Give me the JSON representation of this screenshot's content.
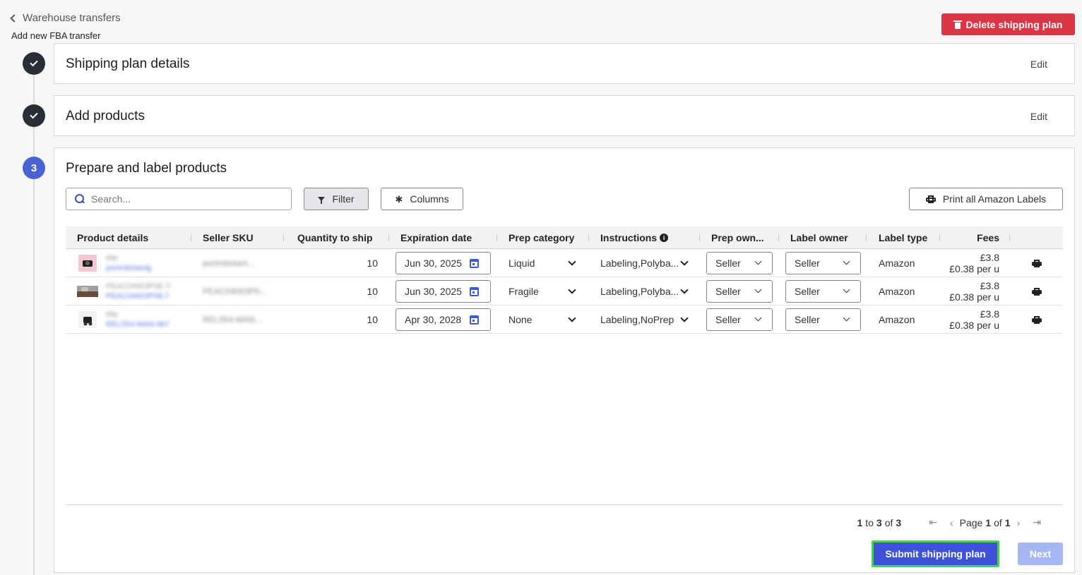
{
  "header": {
    "back_label": "Warehouse transfers",
    "subtitle": "Add new FBA transfer",
    "delete_label": "Delete shipping plan",
    "delete_color": "#dc3545"
  },
  "steps": [
    {
      "number": "",
      "status": "done",
      "title": "Shipping plan details",
      "edit_label": "Edit"
    },
    {
      "number": "",
      "status": "done",
      "title": "Add products",
      "edit_label": "Edit"
    },
    {
      "number": "3",
      "status": "active",
      "title": "Prepare and label products"
    }
  ],
  "toolbar": {
    "search_placeholder": "Search...",
    "filter_label": "Filter",
    "columns_label": "Columns",
    "print_all_label": "Print all Amazon Labels"
  },
  "table": {
    "columns": [
      "Product details",
      "Seller SKU",
      "Quantity to ship",
      "Expiration date",
      "Prep category",
      "Instructions",
      "Prep own...",
      "Label owner",
      "Label type",
      "Fees"
    ],
    "rows": [
      {
        "title": "title",
        "product_link": "portmbotanig",
        "sku": "portmbotani...",
        "quantity": "10",
        "expiration": "Jun 30, 2025",
        "prep_category": "Liquid",
        "instructions": "Labeling,Polyba...",
        "prep_owner": "Seller",
        "label_owner": "Seller",
        "label_type": "Amazon",
        "fee_1": "£3.8",
        "fee_2": "£0.38 per u"
      },
      {
        "title": "PEAC04003P08.7i",
        "product_link": "PEAC04003P08.7",
        "sku": "PEAC04003P0...",
        "quantity": "10",
        "expiration": "Jun 30, 2025",
        "prep_category": "Fragile",
        "instructions": "Labeling,Polyba...",
        "prep_owner": "Seller",
        "label_owner": "Seller",
        "label_type": "Amazon",
        "fee_1": "£3.8",
        "fee_2": "£0.38 per u"
      },
      {
        "title": "title",
        "product_link": "REL554-MAN-967",
        "sku": "REL554-MAN...",
        "quantity": "10",
        "expiration": "Apr 30, 2028",
        "prep_category": "None",
        "instructions": "Labeling,NoPrep",
        "prep_owner": "Seller",
        "label_owner": "Seller",
        "label_type": "Amazon",
        "fee_1": "£3.8",
        "fee_2": "£0.38 per u"
      }
    ]
  },
  "pagination": {
    "range_start": "1",
    "range_to": "to",
    "range_end": "3",
    "range_of": "of",
    "total": "3",
    "page_label": "Page",
    "page_current": "1",
    "page_of": "of",
    "page_total": "1"
  },
  "footer": {
    "submit_label": "Submit shipping plan",
    "next_label": "Next",
    "accent_color": "#3f51d6"
  }
}
